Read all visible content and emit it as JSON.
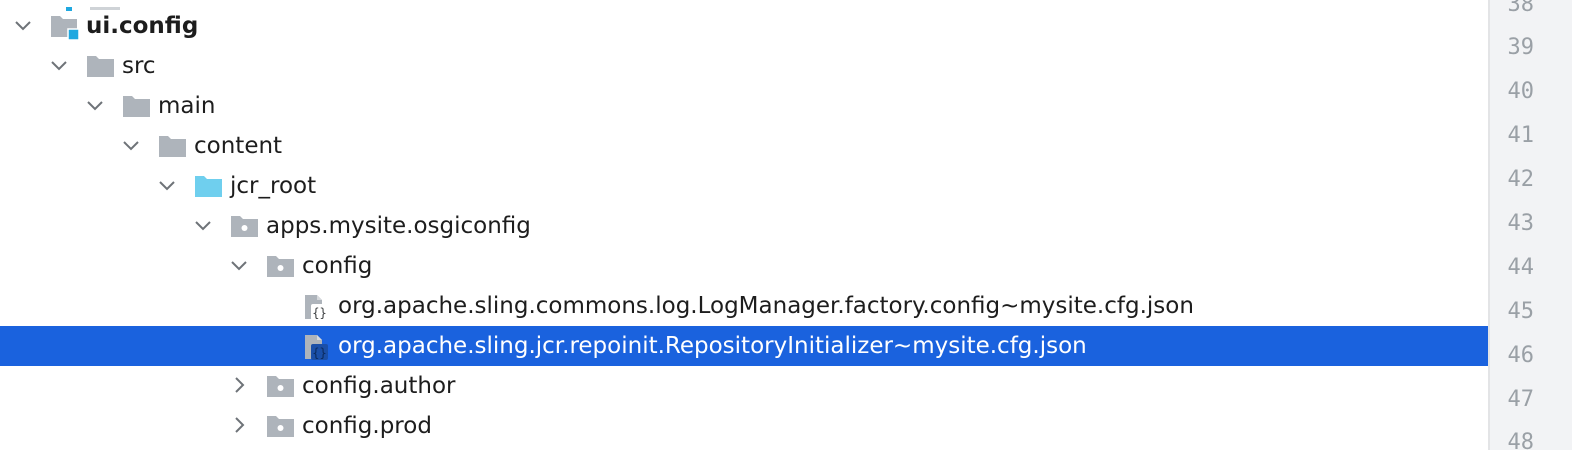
{
  "tree": {
    "rows": [
      {
        "label": "ui.config",
        "bold": true,
        "expanded": true,
        "icon": "module-folder-icon",
        "level": 0,
        "selected": false
      },
      {
        "label": "src",
        "expanded": true,
        "icon": "folder-icon",
        "level": 1,
        "selected": false
      },
      {
        "label": "main",
        "expanded": true,
        "icon": "folder-icon",
        "level": 2,
        "selected": false
      },
      {
        "label": "content",
        "expanded": true,
        "icon": "folder-icon",
        "level": 3,
        "selected": false
      },
      {
        "label": "jcr_root",
        "expanded": true,
        "icon": "resource-root-folder-icon",
        "level": 4,
        "selected": false
      },
      {
        "label": "apps.mysite.osgiconfig",
        "expanded": true,
        "icon": "package-folder-icon",
        "level": 5,
        "selected": false
      },
      {
        "label": "config",
        "expanded": true,
        "icon": "package-folder-icon",
        "level": 6,
        "selected": false
      },
      {
        "label": "org.apache.sling.commons.log.LogManager.factory.config~mysite.cfg.json",
        "expanded": null,
        "icon": "json-file-icon",
        "level": 7,
        "selected": false
      },
      {
        "label": "org.apache.sling.jcr.repoinit.RepositoryInitializer~mysite.cfg.json",
        "expanded": null,
        "icon": "json-file-icon",
        "level": 7,
        "selected": true
      },
      {
        "label": "config.author",
        "expanded": false,
        "icon": "package-folder-icon",
        "level": 6,
        "selected": false
      },
      {
        "label": "config.prod",
        "expanded": false,
        "icon": "package-folder-icon",
        "level": 6,
        "selected": false
      }
    ]
  },
  "gutter": {
    "line_numbers": [
      "38",
      "39",
      "40",
      "41",
      "42",
      "43",
      "44",
      "45",
      "46",
      "47",
      "48"
    ]
  },
  "colors": {
    "selection": "#1a62de",
    "folder": "#aeb4bb",
    "resource_folder": "#6fcfee",
    "module_marker": "#1fa8e0",
    "gutter_bg": "#f2f3f5",
    "line_number": "#9aa0a6"
  }
}
